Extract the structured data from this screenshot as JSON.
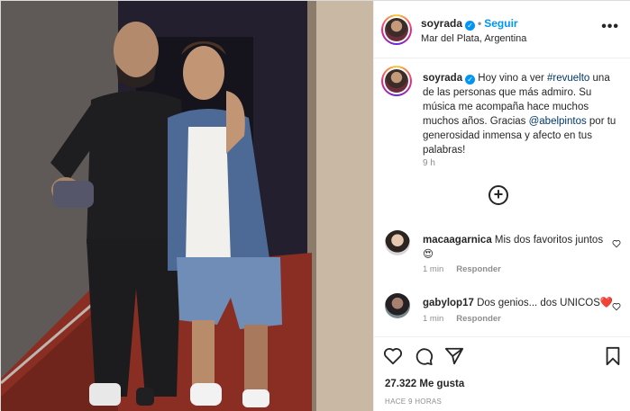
{
  "post": {
    "author": "soyrada",
    "follow_label": "Seguir",
    "location": "Mar del Plata, Argentina",
    "more_label": "•••"
  },
  "caption": {
    "user": "soyrada",
    "text_part1": " Hoy vino a ver ",
    "hashtag": "#revuelto",
    "text_part2": " una de las personas que más admiro. Su música me acompaña hace muchos muchos años. Gracias ",
    "mention": "@abelpintos",
    "text_part3": " por tu generosidad inmensa y afecto en tus palabras!",
    "time": "9 h"
  },
  "comments": [
    {
      "user": "macaagarnica",
      "text": "Mis dos favoritos juntos",
      "emoji": "😍",
      "time": "1 min",
      "reply_label": "Responder"
    },
    {
      "user": "gabylop17",
      "text": "Dos genios... dos UNICOS",
      "emoji": "❤️",
      "time": "1 min",
      "reply_label": "Responder"
    }
  ],
  "footer": {
    "likes": "27.322 Me gusta",
    "ago": "HACE 9 HORAS"
  },
  "icons": {
    "verified": "verified-badge-icon",
    "add_comment": "add-circle-icon",
    "like": "heart-icon",
    "comment": "comment-bubble-icon",
    "share": "paper-plane-icon",
    "save": "bookmark-icon"
  },
  "colors": {
    "accent": "#0095f6",
    "link": "#00376b",
    "muted": "#8e8e8e",
    "heart": "#ed4956"
  }
}
